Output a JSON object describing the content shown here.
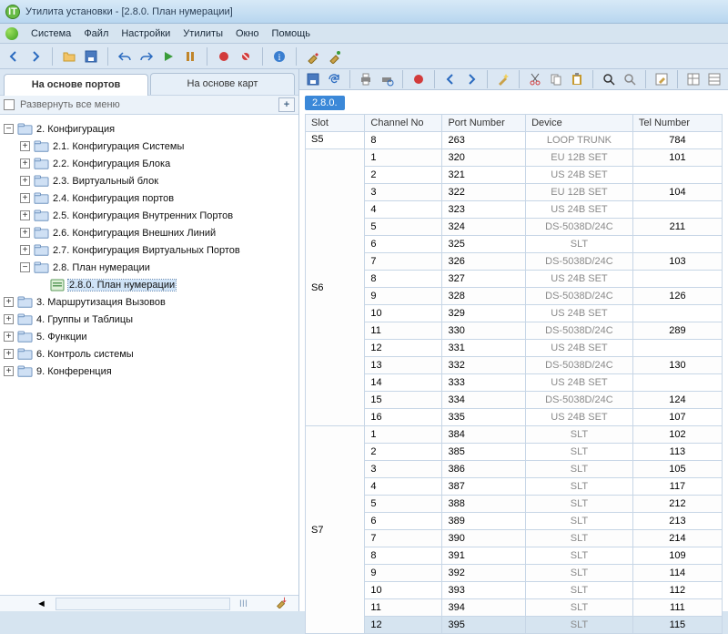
{
  "window": {
    "title": "Утилита установки - [2.8.0. План нумерации]"
  },
  "menu": {
    "items": [
      "Система",
      "Файл",
      "Настройки",
      "Утилиты",
      "Окно",
      "Помощь"
    ]
  },
  "tabs": {
    "left": "На основе портов",
    "right": "На основе карт"
  },
  "expand_all": {
    "label": "Развернуть все меню",
    "plus": "+"
  },
  "tree": {
    "root": {
      "label": "2. Конфигурация",
      "children": [
        {
          "label": "2.1. Конфигурация Системы"
        },
        {
          "label": "2.2. Конфигурация Блока"
        },
        {
          "label": "2.3. Виртуальный блок"
        },
        {
          "label": "2.4. Конфигурация портов"
        },
        {
          "label": "2.5. Конфигурация Внутренних Портов"
        },
        {
          "label": "2.6. Конфигурация Внешних Линий"
        },
        {
          "label": "2.7. Конфигурация Виртуальных Портов"
        },
        {
          "label": "2.8. План нумерации",
          "open": true,
          "children": [
            {
              "label": "2.8.0. План нумерации",
              "leaf": true,
              "selected": true
            }
          ]
        }
      ]
    },
    "siblings": [
      {
        "label": "3. Маршрутизация Вызовов"
      },
      {
        "label": "4. Группы и Таблицы"
      },
      {
        "label": "5. Функции"
      },
      {
        "label": "6. Контроль системы"
      },
      {
        "label": "9. Конференция"
      }
    ]
  },
  "status": {
    "caret": "◄",
    "mid": "III",
    "down": "▼"
  },
  "breadcrumb": "2.8.0.",
  "table": {
    "headers": [
      "Slot",
      "Channel No",
      "Port Number",
      "Device",
      "Tel Number"
    ],
    "groups": [
      {
        "slot": "S5",
        "rows": [
          {
            "ch": "8",
            "port": "263",
            "dev": "LOOP TRUNK",
            "tel": "784"
          }
        ]
      },
      {
        "slot": "S6",
        "rows": [
          {
            "ch": "1",
            "port": "320",
            "dev": "EU 12B SET",
            "tel": "101"
          },
          {
            "ch": "2",
            "port": "321",
            "dev": "US 24B SET",
            "tel": ""
          },
          {
            "ch": "3",
            "port": "322",
            "dev": "EU 12B SET",
            "tel": "104"
          },
          {
            "ch": "4",
            "port": "323",
            "dev": "US 24B SET",
            "tel": ""
          },
          {
            "ch": "5",
            "port": "324",
            "dev": "DS-5038D/24C",
            "tel": "211"
          },
          {
            "ch": "6",
            "port": "325",
            "dev": "SLT",
            "tel": ""
          },
          {
            "ch": "7",
            "port": "326",
            "dev": "DS-5038D/24C",
            "tel": "103"
          },
          {
            "ch": "8",
            "port": "327",
            "dev": "US 24B SET",
            "tel": ""
          },
          {
            "ch": "9",
            "port": "328",
            "dev": "DS-5038D/24C",
            "tel": "126"
          },
          {
            "ch": "10",
            "port": "329",
            "dev": "US 24B SET",
            "tel": ""
          },
          {
            "ch": "11",
            "port": "330",
            "dev": "DS-5038D/24C",
            "tel": "289"
          },
          {
            "ch": "12",
            "port": "331",
            "dev": "US 24B SET",
            "tel": ""
          },
          {
            "ch": "13",
            "port": "332",
            "dev": "DS-5038D/24C",
            "tel": "130"
          },
          {
            "ch": "14",
            "port": "333",
            "dev": "US 24B SET",
            "tel": ""
          },
          {
            "ch": "15",
            "port": "334",
            "dev": "DS-5038D/24C",
            "tel": "124"
          },
          {
            "ch": "16",
            "port": "335",
            "dev": "US 24B SET",
            "tel": "107"
          }
        ]
      },
      {
        "slot": "S7",
        "rows": [
          {
            "ch": "1",
            "port": "384",
            "dev": "SLT",
            "tel": "102"
          },
          {
            "ch": "2",
            "port": "385",
            "dev": "SLT",
            "tel": "113"
          },
          {
            "ch": "3",
            "port": "386",
            "dev": "SLT",
            "tel": "105"
          },
          {
            "ch": "4",
            "port": "387",
            "dev": "SLT",
            "tel": "117"
          },
          {
            "ch": "5",
            "port": "388",
            "dev": "SLT",
            "tel": "212"
          },
          {
            "ch": "6",
            "port": "389",
            "dev": "SLT",
            "tel": "213"
          },
          {
            "ch": "7",
            "port": "390",
            "dev": "SLT",
            "tel": "214"
          },
          {
            "ch": "8",
            "port": "391",
            "dev": "SLT",
            "tel": "109"
          },
          {
            "ch": "9",
            "port": "392",
            "dev": "SLT",
            "tel": "114"
          },
          {
            "ch": "10",
            "port": "393",
            "dev": "SLT",
            "tel": "112"
          },
          {
            "ch": "11",
            "port": "394",
            "dev": "SLT",
            "tel": "111"
          },
          {
            "ch": "12",
            "port": "395",
            "dev": "SLT",
            "tel": "115"
          }
        ]
      }
    ]
  }
}
